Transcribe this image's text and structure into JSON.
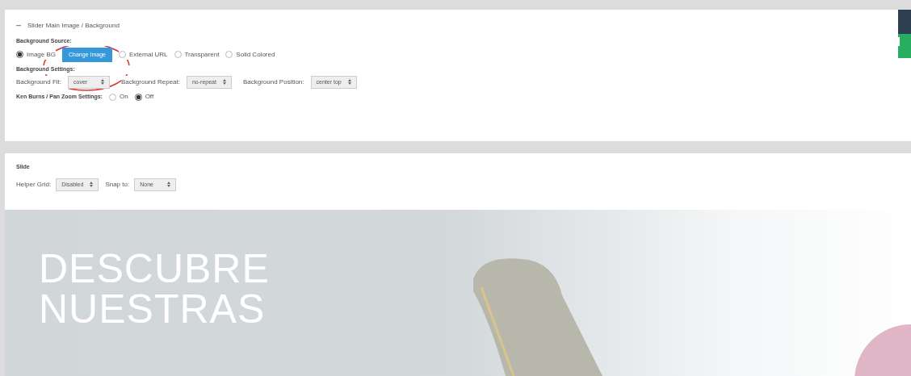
{
  "background_panel": {
    "title": "Slider Main Image / Background",
    "source_label": "Background Source:",
    "source_options": [
      {
        "label": "Image BG",
        "selected": true
      },
      {
        "label": "External URL",
        "selected": false
      },
      {
        "label": "Transparent",
        "selected": false
      },
      {
        "label": "Solid Colored",
        "selected": false
      }
    ],
    "change_button": "Change Image",
    "settings_label": "Background Settings:",
    "settings": [
      {
        "label": "Background Fit:",
        "value": "cover"
      },
      {
        "label": "Background Repeat:",
        "value": "no-repeat"
      },
      {
        "label": "Background Position:",
        "value": "center top"
      }
    ],
    "kenburns_label": "Ken Burns / Pan Zoom Settings:",
    "kenburns_options": [
      {
        "label": "On",
        "selected": false
      },
      {
        "label": "Off",
        "selected": true
      }
    ]
  },
  "slide_panel": {
    "title": "Slide",
    "controls": [
      {
        "label": "Helper Grid:",
        "value": "Disabled"
      },
      {
        "label": "Snap to:",
        "value": "None"
      }
    ]
  },
  "slide": {
    "heading_lines": [
      "DESCUBRE",
      "NUESTRAS"
    ]
  }
}
